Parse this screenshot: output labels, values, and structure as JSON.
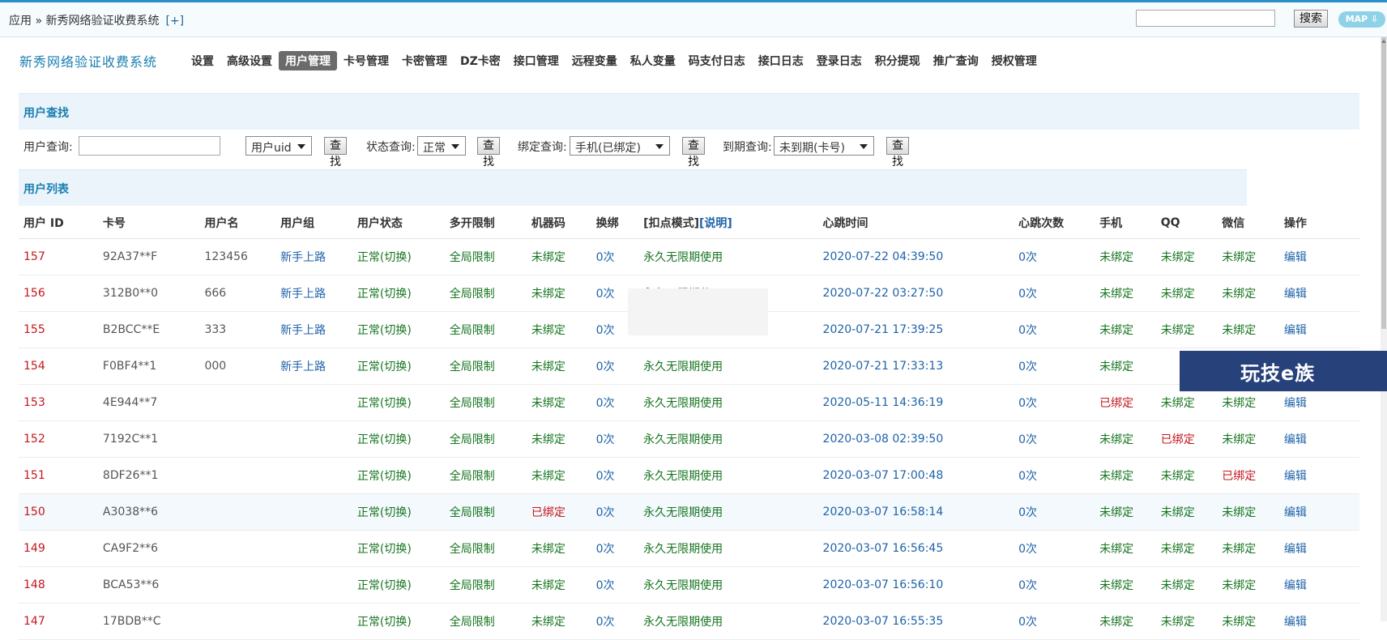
{
  "breadcrumb": {
    "text": "应用 » 新秀网络验证收费系统",
    "plus": "[+]"
  },
  "top_search": {
    "value": "",
    "button": "搜索",
    "map": "MAP ⇩"
  },
  "app_name": "新秀网络验证收费系统",
  "nav": [
    "设置",
    "高级设置",
    "用户管理",
    "卡号管理",
    "卡密管理",
    "DZ卡密",
    "接口管理",
    "远程变量",
    "私人变量",
    "码支付日志",
    "接口日志",
    "登录日志",
    "积分提现",
    "推广查询",
    "授权管理"
  ],
  "nav_active": "用户管理",
  "search_section": {
    "title": "用户查找",
    "user_query_label": "用户查询:",
    "user_query_value": "",
    "user_field_select": "用户uid",
    "status_label": "状态查询:",
    "status_select": "正常",
    "bind_label": "绑定查询:",
    "bind_select": "手机(已绑定)",
    "expire_label": "到期查询:",
    "expire_select": "未到期(卡号)",
    "find_button": "查找"
  },
  "list_section": {
    "title": "用户列表"
  },
  "columns": [
    "用户 ID",
    "卡号",
    "用户名",
    "用户组",
    "用户状态",
    "多开限制",
    "机器码",
    "换绑",
    "[扣点模式]",
    "[说明]",
    "心跳时间",
    "心跳次数",
    "手机",
    "QQ",
    "微信",
    "操作"
  ],
  "rows": [
    {
      "id": "157",
      "card": "92A37**F",
      "username": "123456",
      "group": "新手上路",
      "status": "正常(切换)",
      "multi": "全局限制",
      "machine": "未绑定",
      "rebind": "0次",
      "mode": "永久无限期使用",
      "heartbeat": "2020-07-22 04:39:50",
      "hb_count": "0次",
      "phone": "未绑定",
      "qq": "未绑定",
      "wechat": "未绑定",
      "action": "编辑"
    },
    {
      "id": "156",
      "card": "312B0**0",
      "username": "666",
      "group": "新手上路",
      "status": "正常(切换)",
      "multi": "全局限制",
      "machine": "未绑定",
      "rebind": "0次",
      "mode": "永久无限期使用",
      "heartbeat": "2020-07-22 03:27:50",
      "hb_count": "0次",
      "phone": "未绑定",
      "qq": "未绑定",
      "wechat": "未绑定",
      "action": "编辑"
    },
    {
      "id": "155",
      "card": "B2BCC**E",
      "username": "333",
      "group": "新手上路",
      "status": "正常(切换)",
      "multi": "全局限制",
      "machine": "未绑定",
      "rebind": "0次",
      "mode": "",
      "heartbeat": "2020-07-21 17:39:25",
      "hb_count": "0次",
      "phone": "未绑定",
      "qq": "未绑定",
      "wechat": "未绑定",
      "action": "编辑"
    },
    {
      "id": "154",
      "card": "F0BF4**1",
      "username": "000",
      "group": "新手上路",
      "status": "正常(切换)",
      "multi": "全局限制",
      "machine": "未绑定",
      "rebind": "0次",
      "mode": "永久无限期使用",
      "heartbeat": "2020-07-21 17:33:13",
      "hb_count": "0次",
      "phone": "未绑定",
      "qq": "",
      "wechat": "",
      "action": ""
    },
    {
      "id": "153",
      "card": "4E944**7",
      "username": "",
      "group": "",
      "status": "正常(切换)",
      "multi": "全局限制",
      "machine": "未绑定",
      "rebind": "0次",
      "mode": "永久无限期使用",
      "heartbeat": "2020-05-11 14:36:19",
      "hb_count": "0次",
      "phone": "已绑定",
      "qq": "未绑定",
      "wechat": "未绑定",
      "action": "编辑"
    },
    {
      "id": "152",
      "card": "7192C**1",
      "username": "",
      "group": "",
      "status": "正常(切换)",
      "multi": "全局限制",
      "machine": "未绑定",
      "rebind": "0次",
      "mode": "永久无限期使用",
      "heartbeat": "2020-03-08 02:39:50",
      "hb_count": "0次",
      "phone": "未绑定",
      "qq": "已绑定",
      "wechat": "未绑定",
      "action": "编辑"
    },
    {
      "id": "151",
      "card": "8DF26**1",
      "username": "",
      "group": "",
      "status": "正常(切换)",
      "multi": "全局限制",
      "machine": "未绑定",
      "rebind": "0次",
      "mode": "永久无限期使用",
      "heartbeat": "2020-03-07 17:00:48",
      "hb_count": "0次",
      "phone": "未绑定",
      "qq": "未绑定",
      "wechat": "已绑定",
      "action": "编辑"
    },
    {
      "id": "150",
      "card": "A3038**6",
      "username": "",
      "group": "",
      "status": "正常(切换)",
      "multi": "全局限制",
      "machine": "已绑定",
      "rebind": "0次",
      "mode": "永久无限期使用",
      "heartbeat": "2020-03-07 16:58:14",
      "hb_count": "0次",
      "phone": "未绑定",
      "qq": "未绑定",
      "wechat": "未绑定",
      "action": "编辑"
    },
    {
      "id": "149",
      "card": "CA9F2**6",
      "username": "",
      "group": "",
      "status": "正常(切换)",
      "multi": "全局限制",
      "machine": "未绑定",
      "rebind": "0次",
      "mode": "永久无限期使用",
      "heartbeat": "2020-03-07 16:56:45",
      "hb_count": "0次",
      "phone": "未绑定",
      "qq": "未绑定",
      "wechat": "未绑定",
      "action": "编辑"
    },
    {
      "id": "148",
      "card": "BCA53**6",
      "username": "",
      "group": "",
      "status": "正常(切换)",
      "multi": "全局限制",
      "machine": "未绑定",
      "rebind": "0次",
      "mode": "永久无限期使用",
      "heartbeat": "2020-03-07 16:56:10",
      "hb_count": "0次",
      "phone": "未绑定",
      "qq": "未绑定",
      "wechat": "未绑定",
      "action": "编辑"
    },
    {
      "id": "147",
      "card": "17BDB**C",
      "username": "",
      "group": "",
      "status": "正常(切换)",
      "multi": "全局限制",
      "machine": "未绑定",
      "rebind": "0次",
      "mode": "永久无限期使用",
      "heartbeat": "2020-03-07 16:55:35",
      "hb_count": "0次",
      "phone": "未绑定",
      "qq": "未绑定",
      "wechat": "未绑定",
      "action": "编辑"
    }
  ],
  "highlight_row_id": "150",
  "watermark": "玩技e族",
  "colors": {
    "accent": "#1b7eb1",
    "red": "#c4161c",
    "green": "#16751f",
    "blue": "#1e62a8",
    "active_tab": "#6b6b6b"
  }
}
